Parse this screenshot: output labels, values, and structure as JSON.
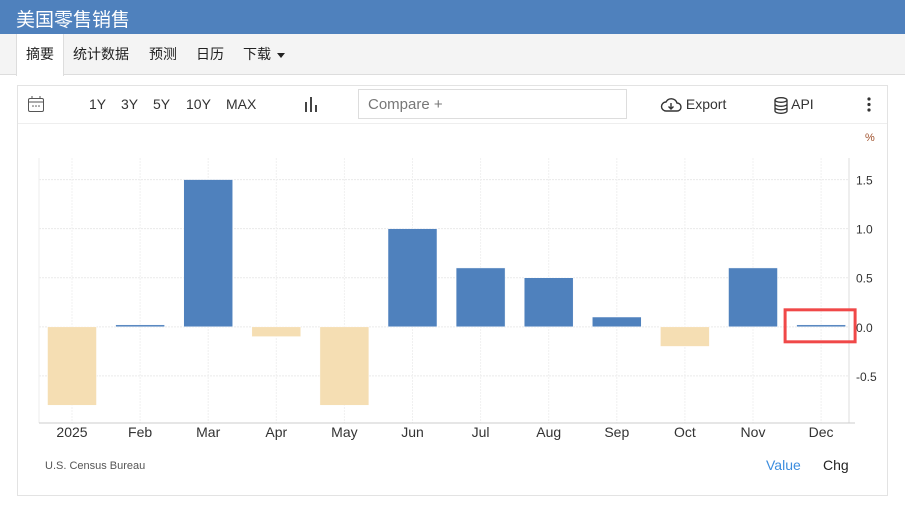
{
  "header": {
    "title": "美国零售销售"
  },
  "nav": {
    "tabs": [
      {
        "label": "摘要",
        "active": true
      },
      {
        "label": "统计数据"
      },
      {
        "label": "预测"
      },
      {
        "label": "日历"
      },
      {
        "label": "下载"
      }
    ]
  },
  "toolbar": {
    "ranges": [
      "1Y",
      "3Y",
      "5Y",
      "10Y",
      "MAX"
    ],
    "compare_placeholder": "Compare +",
    "export_label": "Export",
    "api_label": "API"
  },
  "colors": {
    "positive": "#4f81bd",
    "negative": "#f5deb3",
    "highlight": "#f04848"
  },
  "chart_data": {
    "type": "bar",
    "categories": [
      "2025",
      "Feb",
      "Mar",
      "Apr",
      "May",
      "Jun",
      "Jul",
      "Aug",
      "Sep",
      "Oct",
      "Nov",
      "Dec"
    ],
    "values": [
      -0.8,
      0.02,
      1.5,
      -0.1,
      -0.8,
      1.0,
      0.6,
      0.5,
      0.1,
      -0.2,
      0.6,
      0.02
    ],
    "unit": "%",
    "yticks": [
      "1.5",
      "1.0",
      "0.5",
      "0.0",
      "-0.5"
    ],
    "ytick_values": [
      1.5,
      1.0,
      0.5,
      0.0,
      -0.5
    ],
    "ylim": [
      -0.98,
      1.72
    ],
    "highlighted": "Dec",
    "grid": true,
    "source": "U.S. Census Bureau",
    "legend": {
      "value": "Value",
      "chg": "Chg"
    }
  }
}
